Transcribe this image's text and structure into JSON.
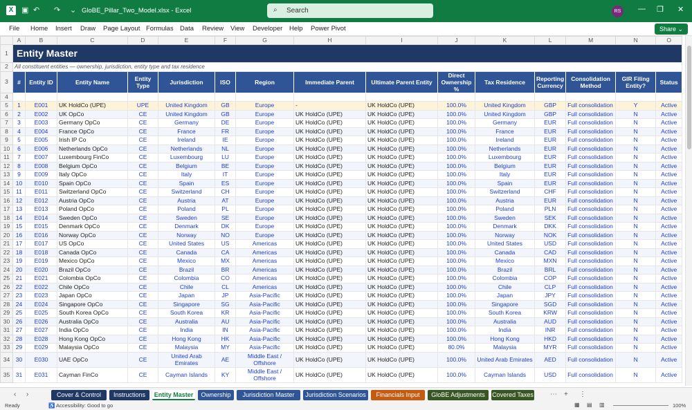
{
  "window": {
    "filename": "GloBE_Pillar_Two_Model.xlsx",
    "app": "Excel",
    "title": "GloBE_Pillar_Two_Model.xlsx  -  Excel",
    "avatar": "RS"
  },
  "search": {
    "placeholder": "Search"
  },
  "menu": [
    "File",
    "Home",
    "Insert",
    "Draw",
    "Page Layout",
    "Formulas",
    "Data",
    "Review",
    "View",
    "Developer",
    "Help",
    "Power Pivot"
  ],
  "share_label": "Share",
  "columns": [
    "A",
    "B",
    "C",
    "D",
    "E",
    "F",
    "G",
    "H",
    "I",
    "J",
    "K",
    "L",
    "M",
    "N",
    "O"
  ],
  "sheet": {
    "title": "Entity Master",
    "subtitle": "All constituent entities — ownership, jurisdiction, entity type and tax residence",
    "headers": [
      "#",
      "Entity ID",
      "Entity Name",
      "Entity Type",
      "Jurisdiction",
      "ISO",
      "Region",
      "Immediate Parent",
      "Ultimate Parent Entity",
      "Direct Ownership %",
      "Tax Residence",
      "Reporting Currency",
      "Consolidation Method",
      "GIR Filing Entity?",
      "Status"
    ],
    "rows": [
      [
        "1",
        "E001",
        "UK HoldCo (UPE)",
        "UPE",
        "United Kingdom",
        "GB",
        "Europe",
        "-",
        "UK HoldCo (UPE)",
        "100.0%",
        "United Kingdom",
        "GBP",
        "Full consolidation",
        "Y",
        "Active"
      ],
      [
        "2",
        "E002",
        "UK OpCo",
        "CE",
        "United Kingdom",
        "GB",
        "Europe",
        "UK HoldCo (UPE)",
        "UK HoldCo (UPE)",
        "100.0%",
        "United Kingdom",
        "GBP",
        "Full consolidation",
        "N",
        "Active"
      ],
      [
        "3",
        "E003",
        "Germany OpCo",
        "CE",
        "Germany",
        "DE",
        "Europe",
        "UK HoldCo (UPE)",
        "UK HoldCo (UPE)",
        "100.0%",
        "Germany",
        "EUR",
        "Full consolidation",
        "N",
        "Active"
      ],
      [
        "4",
        "E004",
        "France OpCo",
        "CE",
        "France",
        "FR",
        "Europe",
        "UK HoldCo (UPE)",
        "UK HoldCo (UPE)",
        "100.0%",
        "France",
        "EUR",
        "Full consolidation",
        "N",
        "Active"
      ],
      [
        "5",
        "E005",
        "Irish IP Co",
        "CE",
        "Ireland",
        "IE",
        "Europe",
        "UK HoldCo (UPE)",
        "UK HoldCo (UPE)",
        "100.0%",
        "Ireland",
        "EUR",
        "Full consolidation",
        "N",
        "Active"
      ],
      [
        "6",
        "E006",
        "Netherlands OpCo",
        "CE",
        "Netherlands",
        "NL",
        "Europe",
        "UK HoldCo (UPE)",
        "UK HoldCo (UPE)",
        "100.0%",
        "Netherlands",
        "EUR",
        "Full consolidation",
        "N",
        "Active"
      ],
      [
        "7",
        "E007",
        "Luxembourg FinCo",
        "CE",
        "Luxembourg",
        "LU",
        "Europe",
        "UK HoldCo (UPE)",
        "UK HoldCo (UPE)",
        "100.0%",
        "Luxembourg",
        "EUR",
        "Full consolidation",
        "N",
        "Active"
      ],
      [
        "8",
        "E008",
        "Belgium OpCo",
        "CE",
        "Belgium",
        "BE",
        "Europe",
        "UK HoldCo (UPE)",
        "UK HoldCo (UPE)",
        "100.0%",
        "Belgium",
        "EUR",
        "Full consolidation",
        "N",
        "Active"
      ],
      [
        "9",
        "E009",
        "Italy OpCo",
        "CE",
        "Italy",
        "IT",
        "Europe",
        "UK HoldCo (UPE)",
        "UK HoldCo (UPE)",
        "100.0%",
        "Italy",
        "EUR",
        "Full consolidation",
        "N",
        "Active"
      ],
      [
        "10",
        "E010",
        "Spain OpCo",
        "CE",
        "Spain",
        "ES",
        "Europe",
        "UK HoldCo (UPE)",
        "UK HoldCo (UPE)",
        "100.0%",
        "Spain",
        "EUR",
        "Full consolidation",
        "N",
        "Active"
      ],
      [
        "11",
        "E011",
        "Switzerland OpCo",
        "CE",
        "Switzerland",
        "CH",
        "Europe",
        "UK HoldCo (UPE)",
        "UK HoldCo (UPE)",
        "100.0%",
        "Switzerland",
        "CHF",
        "Full consolidation",
        "N",
        "Active"
      ],
      [
        "12",
        "E012",
        "Austria OpCo",
        "CE",
        "Austria",
        "AT",
        "Europe",
        "UK HoldCo (UPE)",
        "UK HoldCo (UPE)",
        "100.0%",
        "Austria",
        "EUR",
        "Full consolidation",
        "N",
        "Active"
      ],
      [
        "13",
        "E013",
        "Poland OpCo",
        "CE",
        "Poland",
        "PL",
        "Europe",
        "UK HoldCo (UPE)",
        "UK HoldCo (UPE)",
        "100.0%",
        "Poland",
        "PLN",
        "Full consolidation",
        "N",
        "Active"
      ],
      [
        "14",
        "E014",
        "Sweden OpCo",
        "CE",
        "Sweden",
        "SE",
        "Europe",
        "UK HoldCo (UPE)",
        "UK HoldCo (UPE)",
        "100.0%",
        "Sweden",
        "SEK",
        "Full consolidation",
        "N",
        "Active"
      ],
      [
        "15",
        "E015",
        "Denmark OpCo",
        "CE",
        "Denmark",
        "DK",
        "Europe",
        "UK HoldCo (UPE)",
        "UK HoldCo (UPE)",
        "100.0%",
        "Denmark",
        "DKK",
        "Full consolidation",
        "N",
        "Active"
      ],
      [
        "16",
        "E016",
        "Norway OpCo",
        "CE",
        "Norway",
        "NO",
        "Europe",
        "UK HoldCo (UPE)",
        "UK HoldCo (UPE)",
        "100.0%",
        "Norway",
        "NOK",
        "Full consolidation",
        "N",
        "Active"
      ],
      [
        "17",
        "E017",
        "US OpCo",
        "CE",
        "United States",
        "US",
        "Americas",
        "UK HoldCo (UPE)",
        "UK HoldCo (UPE)",
        "100.0%",
        "United States",
        "USD",
        "Full consolidation",
        "N",
        "Active"
      ],
      [
        "18",
        "E018",
        "Canada OpCo",
        "CE",
        "Canada",
        "CA",
        "Americas",
        "UK HoldCo (UPE)",
        "UK HoldCo (UPE)",
        "100.0%",
        "Canada",
        "CAD",
        "Full consolidation",
        "N",
        "Active"
      ],
      [
        "19",
        "E019",
        "Mexico OpCo",
        "CE",
        "Mexico",
        "MX",
        "Americas",
        "UK HoldCo (UPE)",
        "UK HoldCo (UPE)",
        "100.0%",
        "Mexico",
        "MXN",
        "Full consolidation",
        "N",
        "Active"
      ],
      [
        "20",
        "E020",
        "Brazil OpCo",
        "CE",
        "Brazil",
        "BR",
        "Americas",
        "UK HoldCo (UPE)",
        "UK HoldCo (UPE)",
        "100.0%",
        "Brazil",
        "BRL",
        "Full consolidation",
        "N",
        "Active"
      ],
      [
        "21",
        "E021",
        "Colombia OpCo",
        "CE",
        "Colombia",
        "CO",
        "Americas",
        "UK HoldCo (UPE)",
        "UK HoldCo (UPE)",
        "100.0%",
        "Colombia",
        "COP",
        "Full consolidation",
        "N",
        "Active"
      ],
      [
        "22",
        "E022",
        "Chile OpCo",
        "CE",
        "Chile",
        "CL",
        "Americas",
        "UK HoldCo (UPE)",
        "UK HoldCo (UPE)",
        "100.0%",
        "Chile",
        "CLP",
        "Full consolidation",
        "N",
        "Active"
      ],
      [
        "23",
        "E023",
        "Japan OpCo",
        "CE",
        "Japan",
        "JP",
        "Asia-Pacific",
        "UK HoldCo (UPE)",
        "UK HoldCo (UPE)",
        "100.0%",
        "Japan",
        "JPY",
        "Full consolidation",
        "N",
        "Active"
      ],
      [
        "24",
        "E024",
        "Singapore OpCo",
        "CE",
        "Singapore",
        "SG",
        "Asia-Pacific",
        "UK HoldCo (UPE)",
        "UK HoldCo (UPE)",
        "100.0%",
        "Singapore",
        "SGD",
        "Full consolidation",
        "N",
        "Active"
      ],
      [
        "25",
        "E025",
        "South Korea OpCo",
        "CE",
        "South Korea",
        "KR",
        "Asia-Pacific",
        "UK HoldCo (UPE)",
        "UK HoldCo (UPE)",
        "100.0%",
        "South Korea",
        "KRW",
        "Full consolidation",
        "N",
        "Active"
      ],
      [
        "26",
        "E026",
        "Australia OpCo",
        "CE",
        "Australia",
        "AU",
        "Asia-Pacific",
        "UK HoldCo (UPE)",
        "UK HoldCo (UPE)",
        "100.0%",
        "Australia",
        "AUD",
        "Full consolidation",
        "N",
        "Active"
      ],
      [
        "27",
        "E027",
        "India OpCo",
        "CE",
        "India",
        "IN",
        "Asia-Pacific",
        "UK HoldCo (UPE)",
        "UK HoldCo (UPE)",
        "100.0%",
        "India",
        "INR",
        "Full consolidation",
        "N",
        "Active"
      ],
      [
        "28",
        "E028",
        "Hong Kong OpCo",
        "CE",
        "Hong Kong",
        "HK",
        "Asia-Pacific",
        "UK HoldCo (UPE)",
        "UK HoldCo (UPE)",
        "100.0%",
        "Hong Kong",
        "HKD",
        "Full consolidation",
        "N",
        "Active"
      ],
      [
        "29",
        "E029",
        "Malaysia OpCo",
        "CE",
        "Malaysia",
        "MY",
        "Asia-Pacific",
        "UK HoldCo (UPE)",
        "UK HoldCo (UPE)",
        "80.0%",
        "Malaysia",
        "MYR",
        "Full consolidation",
        "N",
        "Active"
      ],
      [
        "30",
        "E030",
        "UAE OpCo",
        "CE",
        "United Arab Emirates",
        "AE",
        "Middle East / Offshore",
        "UK HoldCo (UPE)",
        "UK HoldCo (UPE)",
        "100.0%",
        "United Arab Emirates",
        "AED",
        "Full consolidation",
        "N",
        "Active"
      ],
      [
        "31",
        "E031",
        "Cayman FinCo",
        "CE",
        "Cayman Islands",
        "KY",
        "Middle East / Offshore",
        "UK HoldCo (UPE)",
        "UK HoldCo (UPE)",
        "100.0%",
        "Cayman Islands",
        "USD",
        "Full consolidation",
        "N",
        "Active"
      ]
    ]
  },
  "tabs": [
    {
      "label": "Cover & Control",
      "color": "#1f3864"
    },
    {
      "label": "Instructions",
      "color": "#1f3864"
    },
    {
      "label": "Entity Master",
      "color": "#ffffff",
      "active": true
    },
    {
      "label": "Ownership",
      "color": "#2f5597"
    },
    {
      "label": "Jurisdiction Master",
      "color": "#2f5597"
    },
    {
      "label": "Jurisdiction Scenarios",
      "color": "#2f5597"
    },
    {
      "label": "Financials Input",
      "color": "#c55a11"
    },
    {
      "label": "GloBE Adjustments",
      "color": "#375623"
    },
    {
      "label": "Covered Taxes",
      "color": "#375623"
    }
  ],
  "status": {
    "ready": "Ready",
    "accessibility": "Accessibility: Good to go",
    "zoom": "100%"
  }
}
